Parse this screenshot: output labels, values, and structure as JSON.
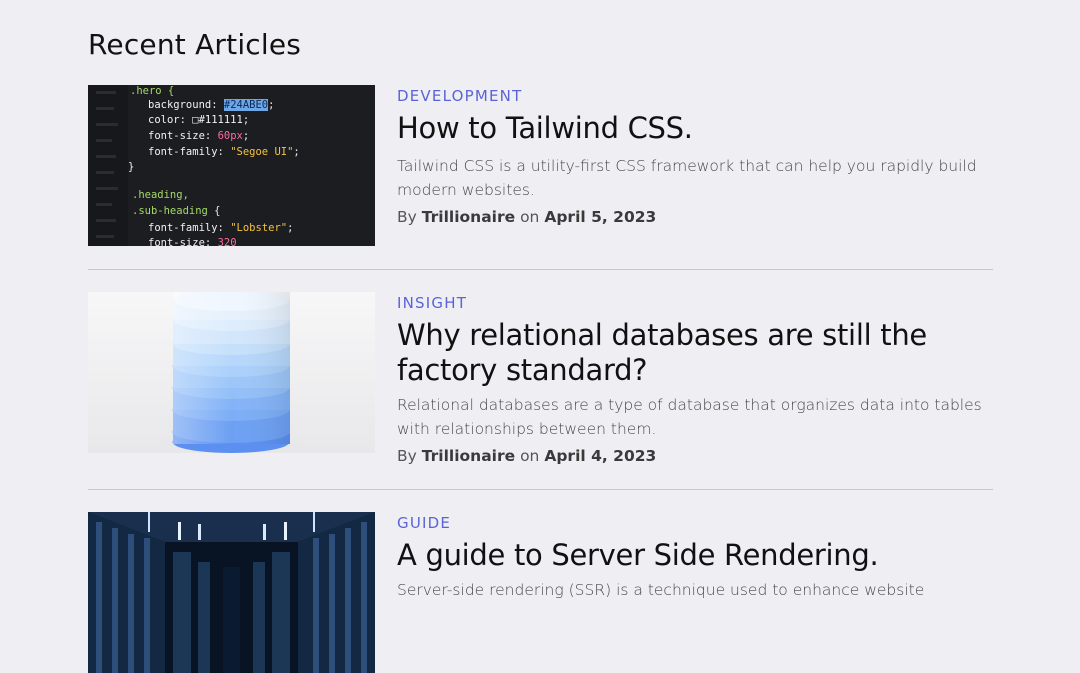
{
  "page": {
    "section_title": "Recent Articles"
  },
  "articles": [
    {
      "category": "DEVELOPMENT",
      "title": "How to Tailwind CSS.",
      "excerpt": "Tailwind CSS is a utility-first CSS framework that can help you rapidly build modern websites.",
      "by_label": "By",
      "author": "Trillionaire",
      "on_label": "on",
      "date": "April 5, 2023",
      "image_icon": "code-screenshot-image"
    },
    {
      "category": "INSIGHT",
      "title": "Why relational databases are still the factory standard?",
      "excerpt": "Relational databases are a type of database that organizes data into tables with relationships between them.",
      "by_label": "By",
      "author": "Trillionaire",
      "on_label": "on",
      "date": "April 4, 2023",
      "image_icon": "database-cylinder-image"
    },
    {
      "category": "GUIDE",
      "title": "A guide to Server Side Rendering.",
      "excerpt": "Server-side rendering (SSR) is a technique used to enhance website",
      "image_icon": "server-room-image"
    }
  ],
  "code_image": {
    "lines": [
      ".hero {",
      "background: #24ABE0;",
      "color: #111111;",
      "font-size: 60px;",
      "font-family: \"Segoe UI\";",
      "}",
      ".heading,",
      ".sub-heading {",
      "font-family: \"Lobster\";",
      "font-size: 320"
    ]
  },
  "colors": {
    "background": "#efeff3",
    "category_accent": "#5a63d8",
    "divider": "#c8c8cc"
  }
}
